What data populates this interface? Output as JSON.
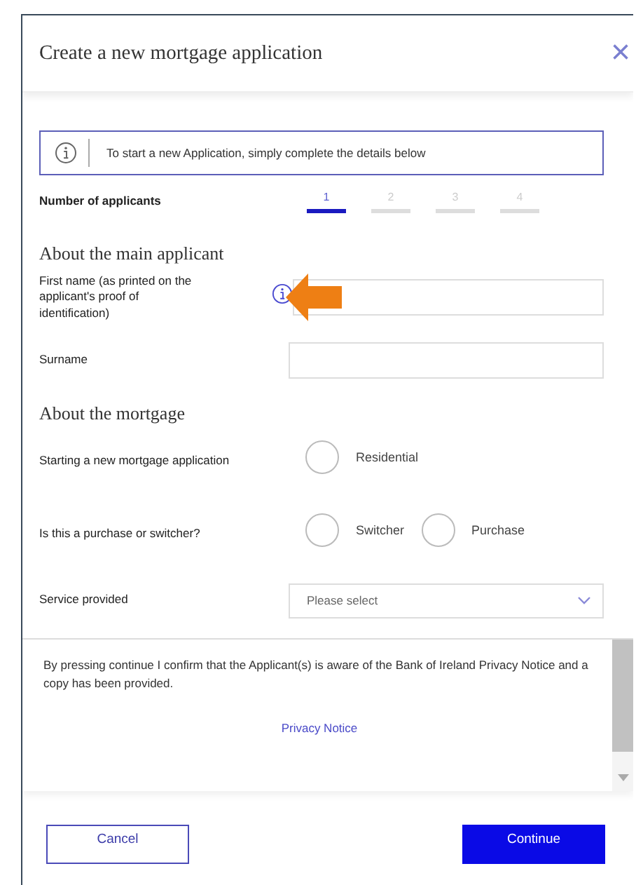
{
  "dialog": {
    "title": "Create a new mortgage application",
    "close": "×"
  },
  "info_banner": {
    "text": "To start a new Application, simply complete the details below"
  },
  "applicants": {
    "label": "Number of applicants",
    "tabs": [
      {
        "label": "1",
        "selected": true
      },
      {
        "label": "2",
        "selected": false
      },
      {
        "label": "3",
        "selected": false
      },
      {
        "label": "4",
        "selected": false
      }
    ]
  },
  "main_applicant": {
    "heading": "About the main applicant",
    "fields": [
      {
        "label": "First name (as printed on the applicant's proof of identification)",
        "info": true,
        "annotated": true
      },
      {
        "label": "Surname",
        "info": false,
        "annotated": false
      }
    ]
  },
  "mortgage": {
    "heading": "About the mortgage",
    "questions": [
      {
        "label": "Starting a new mortgage application",
        "options": [
          {
            "label": "Residential",
            "selected": false
          }
        ]
      },
      {
        "label": "Is this a purchase or switcher?",
        "options": [
          {
            "label": "Switcher",
            "selected": false
          },
          {
            "label": "Purchase",
            "selected": false
          }
        ]
      }
    ],
    "service": {
      "label": "Service provided",
      "placeholder": "Please select"
    }
  },
  "consent": {
    "text": "By pressing continue I confirm that the Applicant(s) is aware of the Bank of Ireland Privacy Notice and a copy has been provided.",
    "link": "Privacy Notice"
  },
  "buttons": [
    {
      "label": "Cancel",
      "kind": "secondary"
    },
    {
      "label": "Continue",
      "kind": "primary"
    }
  ]
}
